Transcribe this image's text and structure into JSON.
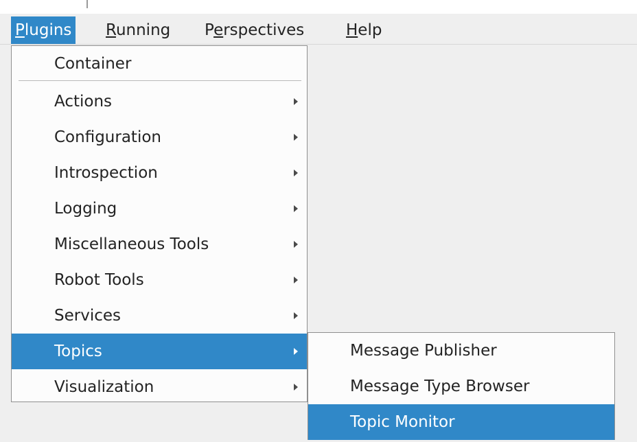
{
  "menubar": {
    "items": [
      {
        "label": "Plugins",
        "mnemonic": "P",
        "rest": "lugins"
      },
      {
        "label": "Running",
        "mnemonic": "R",
        "rest": "unning"
      },
      {
        "label": "Perspectives",
        "pre": "P",
        "mnemonic": "e",
        "rest": "rspectives"
      },
      {
        "label": "Help",
        "mnemonic": "H",
        "rest": "elp"
      }
    ]
  },
  "plugins_menu": {
    "container_label": "Container",
    "items": [
      {
        "label": "Actions"
      },
      {
        "label": "Configuration"
      },
      {
        "label": "Introspection"
      },
      {
        "label": "Logging"
      },
      {
        "label": "Miscellaneous Tools"
      },
      {
        "label": "Robot Tools"
      },
      {
        "label": "Services"
      },
      {
        "label": "Topics"
      },
      {
        "label": "Visualization"
      }
    ],
    "highlighted": "Topics"
  },
  "topics_submenu": {
    "items": [
      {
        "label": "Message Publisher"
      },
      {
        "label": "Message Type Browser"
      },
      {
        "label": "Topic Monitor"
      }
    ],
    "highlighted": "Topic Monitor"
  },
  "colors": {
    "highlight": "#3088c8",
    "menu_bg": "#fcfcfc",
    "window_bg": "#efefef"
  }
}
